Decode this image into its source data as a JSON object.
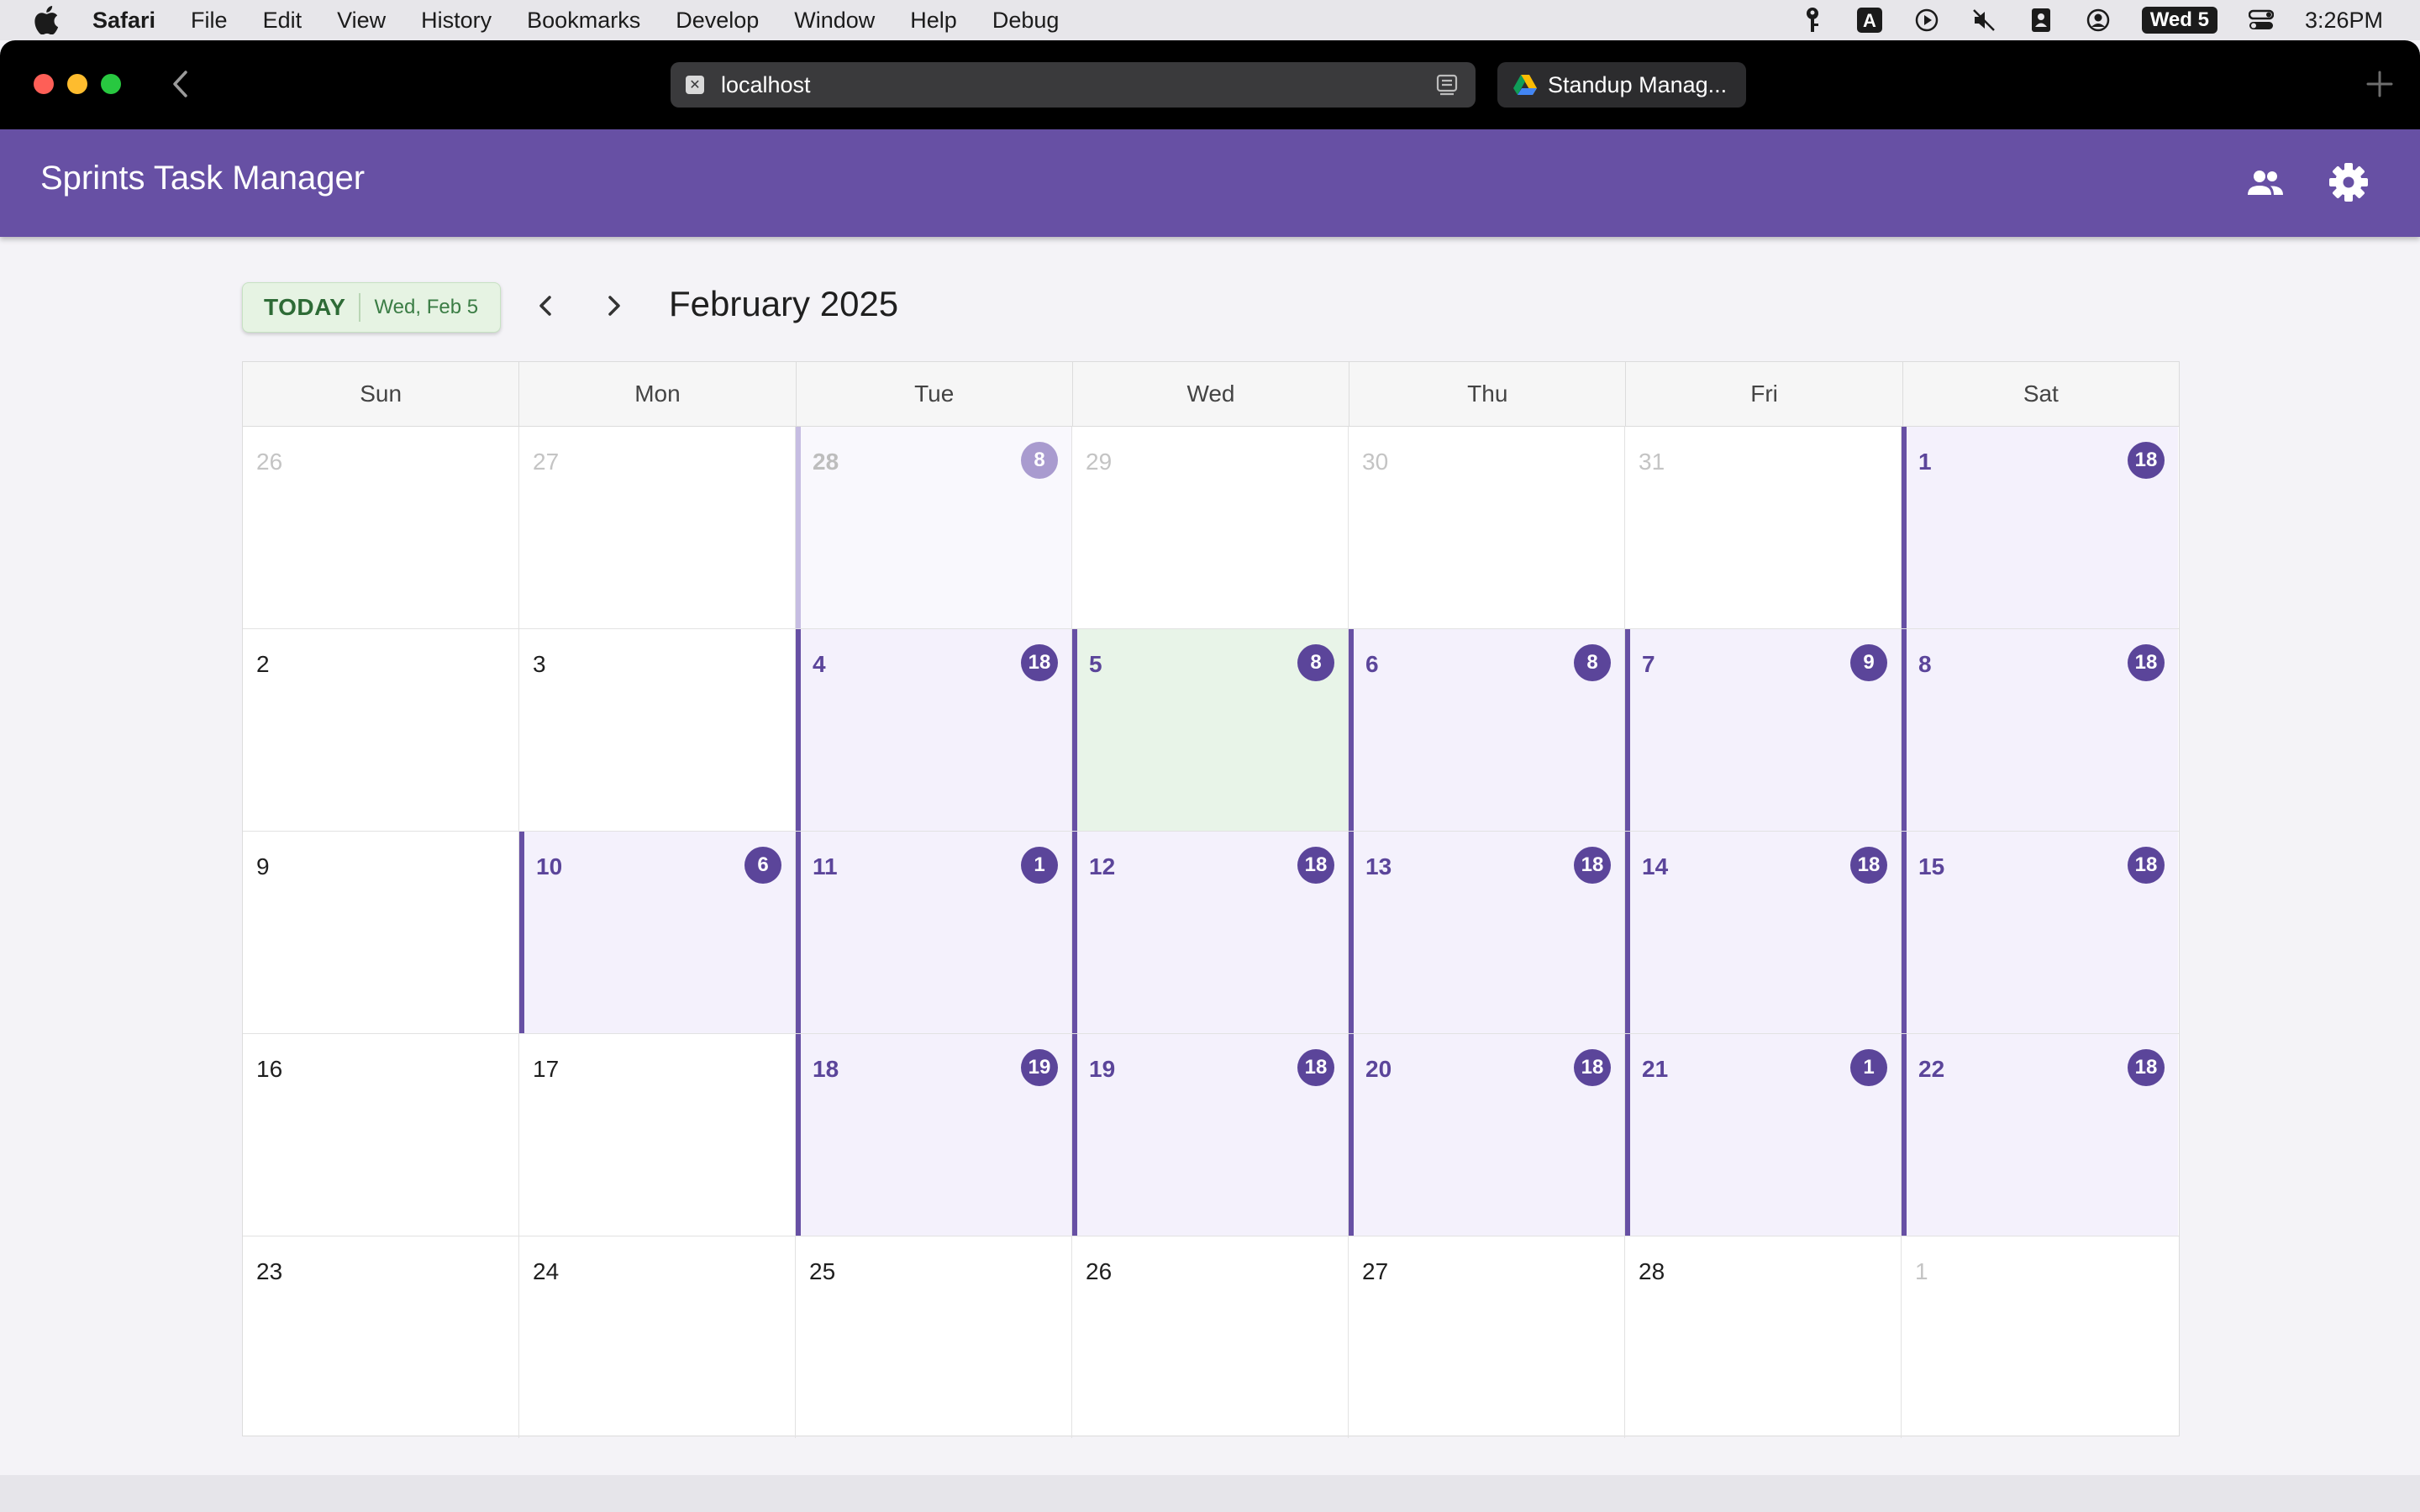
{
  "menubar": {
    "app_name": "Safari",
    "items": [
      "File",
      "Edit",
      "View",
      "History",
      "Bookmarks",
      "Develop",
      "Window",
      "Help",
      "Debug"
    ],
    "date_badge": "Wed 5",
    "time": "3:26PM"
  },
  "browser": {
    "url": "localhost",
    "tab2_label": "Standup Manag..."
  },
  "app": {
    "title": "Sprints Task Manager"
  },
  "toolbar": {
    "today_label": "TODAY",
    "today_date": "Wed, Feb 5",
    "month_title": "February 2025"
  },
  "calendar": {
    "days_of_week": [
      "Sun",
      "Mon",
      "Tue",
      "Wed",
      "Thu",
      "Fri",
      "Sat"
    ],
    "weeks": [
      [
        {
          "day": "26",
          "badge": "",
          "other": true,
          "sprint": false,
          "today": false
        },
        {
          "day": "27",
          "badge": "",
          "other": true,
          "sprint": false,
          "today": false
        },
        {
          "day": "28",
          "badge": "8",
          "other": true,
          "sprint": true,
          "today": false
        },
        {
          "day": "29",
          "badge": "",
          "other": true,
          "sprint": false,
          "today": false
        },
        {
          "day": "30",
          "badge": "",
          "other": true,
          "sprint": false,
          "today": false
        },
        {
          "day": "31",
          "badge": "",
          "other": true,
          "sprint": false,
          "today": false
        },
        {
          "day": "1",
          "badge": "18",
          "other": false,
          "sprint": true,
          "today": false
        }
      ],
      [
        {
          "day": "2",
          "badge": "",
          "other": false,
          "sprint": false,
          "today": false
        },
        {
          "day": "3",
          "badge": "",
          "other": false,
          "sprint": false,
          "today": false
        },
        {
          "day": "4",
          "badge": "18",
          "other": false,
          "sprint": true,
          "today": false
        },
        {
          "day": "5",
          "badge": "8",
          "other": false,
          "sprint": true,
          "today": true
        },
        {
          "day": "6",
          "badge": "8",
          "other": false,
          "sprint": true,
          "today": false
        },
        {
          "day": "7",
          "badge": "9",
          "other": false,
          "sprint": true,
          "today": false
        },
        {
          "day": "8",
          "badge": "18",
          "other": false,
          "sprint": true,
          "today": false
        }
      ],
      [
        {
          "day": "9",
          "badge": "",
          "other": false,
          "sprint": false,
          "today": false
        },
        {
          "day": "10",
          "badge": "6",
          "other": false,
          "sprint": true,
          "today": false
        },
        {
          "day": "11",
          "badge": "1",
          "other": false,
          "sprint": true,
          "today": false
        },
        {
          "day": "12",
          "badge": "18",
          "other": false,
          "sprint": true,
          "today": false
        },
        {
          "day": "13",
          "badge": "18",
          "other": false,
          "sprint": true,
          "today": false
        },
        {
          "day": "14",
          "badge": "18",
          "other": false,
          "sprint": true,
          "today": false
        },
        {
          "day": "15",
          "badge": "18",
          "other": false,
          "sprint": true,
          "today": false
        }
      ],
      [
        {
          "day": "16",
          "badge": "",
          "other": false,
          "sprint": false,
          "today": false
        },
        {
          "day": "17",
          "badge": "",
          "other": false,
          "sprint": false,
          "today": false
        },
        {
          "day": "18",
          "badge": "19",
          "other": false,
          "sprint": true,
          "today": false
        },
        {
          "day": "19",
          "badge": "18",
          "other": false,
          "sprint": true,
          "today": false
        },
        {
          "day": "20",
          "badge": "18",
          "other": false,
          "sprint": true,
          "today": false
        },
        {
          "day": "21",
          "badge": "1",
          "other": false,
          "sprint": true,
          "today": false
        },
        {
          "day": "22",
          "badge": "18",
          "other": false,
          "sprint": true,
          "today": false
        }
      ],
      [
        {
          "day": "23",
          "badge": "",
          "other": false,
          "sprint": false,
          "today": false
        },
        {
          "day": "24",
          "badge": "",
          "other": false,
          "sprint": false,
          "today": false
        },
        {
          "day": "25",
          "badge": "",
          "other": false,
          "sprint": false,
          "today": false
        },
        {
          "day": "26",
          "badge": "",
          "other": false,
          "sprint": false,
          "today": false
        },
        {
          "day": "27",
          "badge": "",
          "other": false,
          "sprint": false,
          "today": false
        },
        {
          "day": "28",
          "badge": "",
          "other": false,
          "sprint": false,
          "today": false
        },
        {
          "day": "1",
          "badge": "",
          "other": true,
          "sprint": false,
          "today": false
        }
      ]
    ]
  },
  "icons": {
    "apple": "apple-icon",
    "key": "key-icon",
    "input_source": "input-source-icon",
    "play": "play-circle-icon",
    "mute": "mute-icon",
    "contacts": "contacts-icon",
    "user": "user-circle-icon",
    "control_center": "control-center-icon",
    "back": "chevron-left-icon",
    "reader": "reader-icon",
    "new_tab": "plus-icon",
    "people": "people-icon",
    "settings": "gear-icon",
    "prev": "chevron-left-icon",
    "next": "chevron-right-icon"
  },
  "colors": {
    "primary": "#6750a4",
    "today_bg": "#e8f4e8",
    "sprint_bg": "#f4f1fc",
    "badge": "#5b459a"
  }
}
